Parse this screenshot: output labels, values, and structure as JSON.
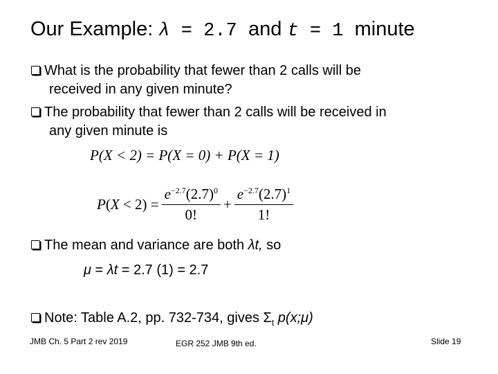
{
  "title": {
    "prefix": "Our Example: ",
    "lambda": "λ",
    "eq1": " = 2.7 ",
    "and": "and ",
    "t": "t",
    "eq2": " = 1 ",
    "suffix": "minute"
  },
  "bullets": [
    {
      "line1": "What is the probability that fewer than 2 calls will be",
      "line2": "received in any given minute?"
    },
    {
      "line1": "The probability that fewer than 2 calls will be received in",
      "line2": "any given minute is"
    }
  ],
  "equation1": "P(X < 2) = P(X = 0) + P(X = 1)",
  "formula": {
    "lhs": "P(X < 2) =",
    "term1_num_e": "e",
    "term1_num_exp": "−2.7",
    "term1_num_base": "(2.7)",
    "term1_num_pow": "0",
    "term1_den": "0!",
    "plus": "+",
    "term2_num_e": "e",
    "term2_num_exp": "−2.7",
    "term2_num_base": "(2.7)",
    "term2_num_pow": "1",
    "term2_den": "1!"
  },
  "mean_bullet": {
    "text": "The mean and variance are both ",
    "italic": "λt,",
    "after": " so"
  },
  "mean_eq": {
    "mu": "μ",
    "mid": " = ",
    "lt": "λt",
    "rest": " = 2.7 (1)  =  2.7"
  },
  "note": {
    "text": "Note: Table A.2, pp. 732-734, gives Σ",
    "sub": "t",
    "after": " ",
    "italic": "p(x;μ)"
  },
  "footer": {
    "left": "JMB Ch. 5 Part 2 rev 2019",
    "center": "EGR 252 JMB 9th ed.",
    "right": "Slide 19"
  }
}
